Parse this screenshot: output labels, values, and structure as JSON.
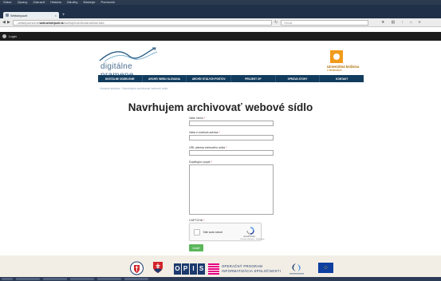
{
  "browser": {
    "menu": [
      "Súbor",
      "Úpravy",
      "Zobraziť",
      "História",
      "Záložky",
      "Nástroje",
      "Pomocník"
    ],
    "tab_title": "Webdepozit",
    "tab_close": "×",
    "new_tab": "+",
    "url_prefix": "...webdepozit.snk.sk/",
    "url_domain": "www.webdepozit.sk",
    "url_suffix": "/navrhujem-archivovat-webove-sidlo",
    "search_placeholder": "Hľadať"
  },
  "site_bar": {
    "login_label": "Login"
  },
  "header": {
    "logo_text": "digitálne pramene",
    "library_line1": "Univerzitná knižnica",
    "library_line2": "v Bratislave"
  },
  "nav": [
    "DIGITÁLNE ODDELENIE",
    "ARCHÍV WEBU SLOVAKIA",
    "ARCHÍV STÁLYCH POSTOV",
    "PROJEKT OP",
    "SPRÁVA STOHY",
    "KONTAKT"
  ],
  "breadcrumb": "Úvodná stránka › Navrhujem archivovať webové sídlo",
  "page": {
    "title": "Navrhujem archivovať webové sídlo"
  },
  "form": {
    "name_label": "Vaše meno",
    "email_label": "Vaša e-mailová adresa",
    "url_label": "URL adresa webového sídla",
    "note_label": "Doplňujúci popis",
    "required_mark": "*",
    "captcha_label": "CAPTCHA",
    "captcha_text": "Nie som robot",
    "captcha_brand": "reCAPTCHA",
    "captcha_links": "Ochrana súkromia · Podmienky",
    "submit_label": "Uložiť"
  },
  "footer": {
    "opis_letters": [
      "O",
      "P",
      "I",
      "S"
    ],
    "opis_line1": "OPERAČNÝ PROGRAM",
    "opis_line2": "INFORMATIZÁCIA SPOLOČNOSTI"
  },
  "taskbar": {
    "clock": ""
  },
  "colors": {
    "nav_bg": "#123c5e",
    "accent_orange": "#f29a1a",
    "submit_green": "#5bb65b",
    "opis_blue": "#1c3a6e",
    "opis_pink": "#e6007e",
    "eu_blue": "#0f3fa0"
  }
}
